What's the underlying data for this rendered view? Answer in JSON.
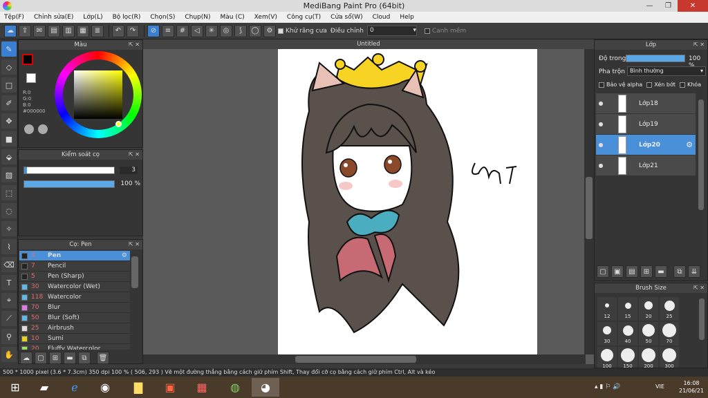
{
  "window": {
    "title": "MediBang Paint Pro (64bit)"
  },
  "menu": [
    "Tệp(F)",
    "Chỉnh sửa(E)",
    "Lớp(L)",
    "Bộ lọc(R)",
    "Chọn(S)",
    "Chụp(N)",
    "Màu (C)",
    "Xem(V)",
    "Công cụ(T)",
    "Cửa sổ(W)",
    "Cloud",
    "Help"
  ],
  "toolbar": {
    "antialias_label": "Khử răng cưa",
    "adjust_label": "Điều chỉnh",
    "adjust_value": "0",
    "edge_label": "Canh mềm"
  },
  "color_panel": {
    "title": "Màu",
    "r": "R:0",
    "g": "G:0",
    "b": "B:0",
    "hex": "#000000",
    "hue_color": "#ffff00"
  },
  "brush_control": {
    "title": "Kiểm soát cọ",
    "size": "3",
    "opacity": "100 %"
  },
  "brush_panel": {
    "title": "Cọ: Pen",
    "items": [
      {
        "size": "3",
        "name": "Pen",
        "color": "#222222"
      },
      {
        "size": "7",
        "name": "Pencil",
        "color": "#222222"
      },
      {
        "size": "5",
        "name": "Pen (Sharp)",
        "color": "#222222"
      },
      {
        "size": "30",
        "name": "Watercolor (Wet)",
        "color": "#5fb8e6"
      },
      {
        "size": "118",
        "name": "Watercolor",
        "color": "#5fb8e6"
      },
      {
        "size": "70",
        "name": "Blur",
        "color": "#e07ae0"
      },
      {
        "size": "50",
        "name": "Blur (Soft)",
        "color": "#5fb8e6"
      },
      {
        "size": "25",
        "name": "Airbrush",
        "color": "#dddddd"
      },
      {
        "size": "10",
        "name": "Sumi",
        "color": "#e8d020"
      },
      {
        "size": "20",
        "name": "Fluffy Watercolor",
        "color": "#9be05a"
      }
    ]
  },
  "canvas": {
    "tab": "Untitled"
  },
  "layer_panel": {
    "title": "Lớp",
    "opacity_label": "Độ trong",
    "opacity_value": "100 %",
    "blend_label": "Pha trộn",
    "blend_value": "Bình thường",
    "protect_alpha": "Bảo vệ alpha",
    "clip": "Xén bớt",
    "lock": "Khóa",
    "layers": [
      {
        "name": "Lớp18"
      },
      {
        "name": "Lớp19"
      },
      {
        "name": "Lớp20"
      },
      {
        "name": "Lớp21"
      }
    ]
  },
  "brush_size_panel": {
    "title": "Brush Size",
    "sizes": [
      "12",
      "15",
      "20",
      "25",
      "30",
      "40",
      "50",
      "70",
      "100",
      "150",
      "200",
      "300"
    ]
  },
  "status": {
    "text": "500 * 1000 pixel   (3.6 * 7.3cm)   350 dpi   100 %   ( 506, 293 )   Vẽ một đường thẳng bằng cách giữ phím Shift, Thay đổi cỡ cọ bằng cách giữ phím Ctrl, Alt và kéo"
  },
  "taskbar": {
    "lang": "VIE",
    "time": "16:08",
    "date": "21/06/21"
  }
}
